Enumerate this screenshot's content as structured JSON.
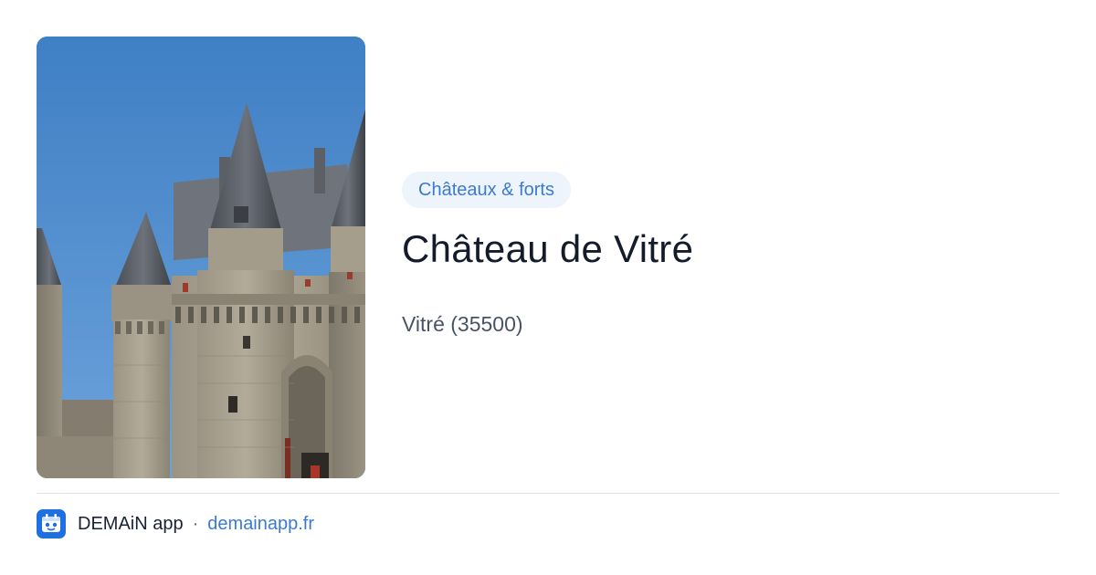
{
  "card": {
    "category": "Châteaux & forts",
    "title": "Château de Vitré",
    "location": "Vitré (35500)"
  },
  "footer": {
    "app_name": "DEMAiN app",
    "separator": "·",
    "site_url": "demainapp.fr"
  },
  "colors": {
    "accent": "#3b7ad0",
    "chip_background": "#eef4fc",
    "title_text": "#141b2b",
    "muted_text": "#4a5366",
    "divider": "#dbe3ea",
    "logo_background": "#1e6fe0"
  },
  "icons": {
    "app_logo": "demain-app-logo-icon"
  }
}
